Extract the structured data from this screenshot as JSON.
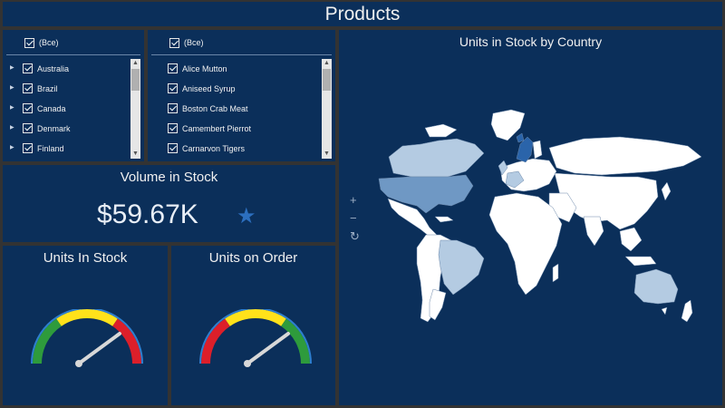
{
  "header": {
    "title": "Products"
  },
  "country_filter": {
    "select_all_label": "(Все)",
    "items": [
      "Australia",
      "Brazil",
      "Canada",
      "Denmark",
      "Finland"
    ]
  },
  "product_filter": {
    "select_all_label": "(Все)",
    "items": [
      "Alice Mutton",
      "Aniseed Syrup",
      "Boston Crab Meat",
      "Camembert Pierrot",
      "Carnarvon Tigers"
    ]
  },
  "kpi": {
    "title": "Volume in Stock",
    "value": "$59.67K",
    "icon": "star-icon"
  },
  "gauge_stock": {
    "title": "Units In Stock",
    "bands": [
      "green",
      "yellow",
      "red"
    ],
    "needle_level": 0.78
  },
  "gauge_order": {
    "title": "Units on Order",
    "bands": [
      "red",
      "yellow",
      "green"
    ],
    "needle_level": 0.78
  },
  "map": {
    "title": "Units in Stock by Country",
    "controls": {
      "zoom_in": "+",
      "zoom_out": "−",
      "reset": "↻"
    }
  },
  "colors": {
    "background": "#333333",
    "panel": "#0b2f5a",
    "land_default": "#ffffff",
    "land_light": "#b4cbe2",
    "land_mid": "#6f98c4",
    "land_dark": "#2a64aa",
    "accent": "#2c6fbf"
  }
}
